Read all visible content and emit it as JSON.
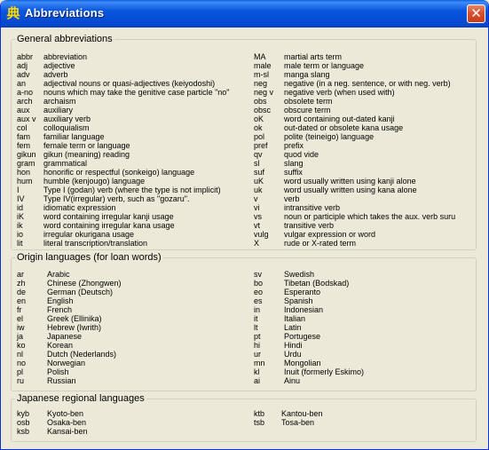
{
  "window": {
    "title": "Abbreviations",
    "app_icon": "kanji-app-icon",
    "close_label": "✕"
  },
  "general": {
    "legend": "General abbreviations",
    "left": [
      {
        "abbr": "abbr",
        "desc": "abbreviation"
      },
      {
        "abbr": "adj",
        "desc": "adjective"
      },
      {
        "abbr": "adv",
        "desc": "adverb"
      },
      {
        "abbr": "an",
        "desc": "adjectival nouns or quasi-adjectives (keiyodoshi)"
      },
      {
        "abbr": "a-no",
        "desc": "nouns which may take the genitive case particle \"no\""
      },
      {
        "abbr": "arch",
        "desc": "archaism"
      },
      {
        "abbr": "aux",
        "desc": "auxiliary"
      },
      {
        "abbr": "aux v",
        "desc": "auxiliary verb"
      },
      {
        "abbr": "col",
        "desc": "colloquialism"
      },
      {
        "abbr": "fam",
        "desc": "familiar language"
      },
      {
        "abbr": "fem",
        "desc": "female term or language"
      },
      {
        "abbr": "gikun",
        "desc": "gikun (meaning) reading"
      },
      {
        "abbr": "gram",
        "desc": "grammatical"
      },
      {
        "abbr": "hon",
        "desc": "honorific or respectful (sonkeigo) language"
      },
      {
        "abbr": "hum",
        "desc": "humble (kenjougo) language"
      },
      {
        "abbr": "I",
        "desc": "Type I (godan) verb (where the type is not implicit)"
      },
      {
        "abbr": "IV",
        "desc": "Type IV(irregular) verb, such as \"gozaru\"."
      },
      {
        "abbr": "id",
        "desc": "idiomatic expression"
      },
      {
        "abbr": "iK",
        "desc": "word containing irregular kanji usage"
      },
      {
        "abbr": "ik",
        "desc": "word containing irregular kana usage"
      },
      {
        "abbr": "io",
        "desc": "irregular okurigana usage"
      },
      {
        "abbr": "lit",
        "desc": "literal transcription/translation"
      }
    ],
    "right": [
      {
        "abbr": "MA",
        "desc": "martial arts term"
      },
      {
        "abbr": "male",
        "desc": "male term or language"
      },
      {
        "abbr": "m-sl",
        "desc": "manga slang"
      },
      {
        "abbr": "neg",
        "desc": "negative (in a neg. sentence, or with neg. verb)"
      },
      {
        "abbr": "neg v",
        "desc": "negative verb (when used with)"
      },
      {
        "abbr": "obs",
        "desc": "obsolete term"
      },
      {
        "abbr": "obsc",
        "desc": "obscure term"
      },
      {
        "abbr": "oK",
        "desc": "word containing out-dated kanji"
      },
      {
        "abbr": "ok",
        "desc": "out-dated or obsolete kana usage"
      },
      {
        "abbr": "pol",
        "desc": "polite (teineigo) language"
      },
      {
        "abbr": "pref",
        "desc": "prefix"
      },
      {
        "abbr": "qv",
        "desc": "quod vide"
      },
      {
        "abbr": "sl",
        "desc": "slang"
      },
      {
        "abbr": "suf",
        "desc": "suffix"
      },
      {
        "abbr": "uK",
        "desc": "word usually written using kanji alone"
      },
      {
        "abbr": "uk",
        "desc": "word usually written using kana alone"
      },
      {
        "abbr": "v",
        "desc": "verb"
      },
      {
        "abbr": "vi",
        "desc": "intransitive verb"
      },
      {
        "abbr": "vs",
        "desc": "noun or participle which takes the aux. verb suru"
      },
      {
        "abbr": "vt",
        "desc": "transitive verb"
      },
      {
        "abbr": "vulg",
        "desc": "vulgar expression or word"
      },
      {
        "abbr": "X",
        "desc": "rude or X-rated term"
      }
    ]
  },
  "origin": {
    "legend": "Origin languages (for loan words)",
    "left": [
      {
        "abbr": "ar",
        "desc": "Arabic"
      },
      {
        "abbr": "zh",
        "desc": "Chinese (Zhongwen)"
      },
      {
        "abbr": "de",
        "desc": "German (Deutsch)"
      },
      {
        "abbr": "en",
        "desc": "English"
      },
      {
        "abbr": "fr",
        "desc": "French"
      },
      {
        "abbr": "el",
        "desc": "Greek (Ellinika)"
      },
      {
        "abbr": "iw",
        "desc": "Hebrew (Iwrith)"
      },
      {
        "abbr": "ja",
        "desc": "Japanese"
      },
      {
        "abbr": "ko",
        "desc": "Korean"
      },
      {
        "abbr": "nl",
        "desc": "Dutch (Nederlands)"
      },
      {
        "abbr": "no",
        "desc": "Norwegian"
      },
      {
        "abbr": "pl",
        "desc": "Polish"
      },
      {
        "abbr": "ru",
        "desc": "Russian"
      }
    ],
    "right": [
      {
        "abbr": "sv",
        "desc": "Swedish"
      },
      {
        "abbr": "bo",
        "desc": "Tibetan (Bodskad)"
      },
      {
        "abbr": "eo",
        "desc": "Esperanto"
      },
      {
        "abbr": "es",
        "desc": "Spanish"
      },
      {
        "abbr": "in",
        "desc": "Indonesian"
      },
      {
        "abbr": "it",
        "desc": "Italian"
      },
      {
        "abbr": "lt",
        "desc": "Latin"
      },
      {
        "abbr": "pt",
        "desc": "Portugese"
      },
      {
        "abbr": "hi",
        "desc": "Hindi"
      },
      {
        "abbr": "ur",
        "desc": "Urdu"
      },
      {
        "abbr": "mn",
        "desc": "Mongolian"
      },
      {
        "abbr": "kl",
        "desc": "Inuit (formerly Eskimo)"
      },
      {
        "abbr": "ai",
        "desc": "Ainu"
      }
    ]
  },
  "regional": {
    "legend": "Japanese regional languages",
    "left": [
      {
        "abbr": "kyb",
        "desc": "Kyoto-ben"
      },
      {
        "abbr": "osb",
        "desc": "Osaka-ben"
      },
      {
        "abbr": "ksb",
        "desc": "Kansai-ben"
      }
    ],
    "right": [
      {
        "abbr": "ktb",
        "desc": "Kantou-ben"
      },
      {
        "abbr": "tsb",
        "desc": "Tosa-ben"
      }
    ]
  }
}
